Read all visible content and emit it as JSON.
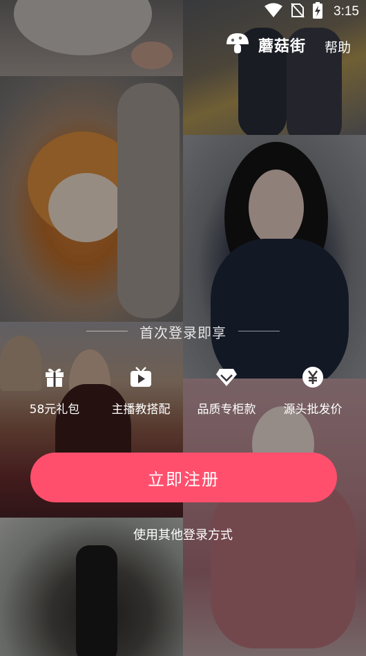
{
  "status_bar": {
    "time": "3:15"
  },
  "header": {
    "brand_name": "蘑菇街",
    "help_label": "帮助"
  },
  "promo": {
    "title": "首次登录即享",
    "benefits": [
      {
        "label": "58元礼包",
        "icon": "gift-icon"
      },
      {
        "label": "主播教搭配",
        "icon": "tv-play-icon"
      },
      {
        "label": "品质专柜款",
        "icon": "diamond-icon"
      },
      {
        "label": "源头批发价",
        "icon": "yen-icon"
      }
    ]
  },
  "actions": {
    "register_label": "立即注册",
    "other_login_label": "使用其他登录方式"
  },
  "colors": {
    "accent": "#ff4f6d"
  }
}
